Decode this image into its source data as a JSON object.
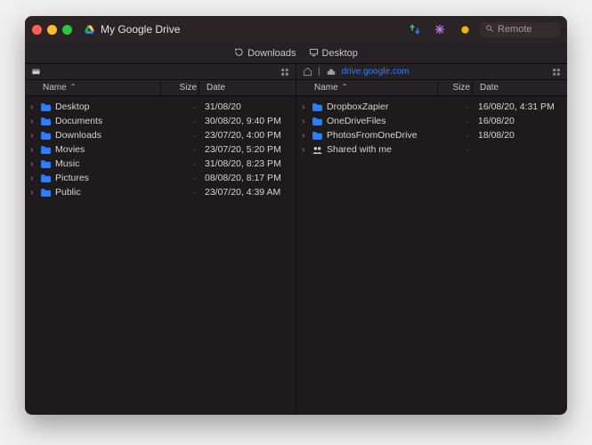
{
  "window": {
    "title": "My Google Drive"
  },
  "search": {
    "placeholder": "Remote"
  },
  "tabs": {
    "downloads": "Downloads",
    "desktop": "Desktop"
  },
  "columns": {
    "name": "Name",
    "size": "Size",
    "date": "Date",
    "sort_asc": "⌃"
  },
  "left": {
    "location": "",
    "view_icon": "list",
    "rows": [
      {
        "name": "Desktop",
        "size": "·",
        "date": "31/08/20"
      },
      {
        "name": "Documents",
        "size": "·",
        "date": "30/08/20, 9:40 PM"
      },
      {
        "name": "Downloads",
        "size": "·",
        "date": "23/07/20, 4:00 PM"
      },
      {
        "name": "Movies",
        "size": "·",
        "date": "23/07/20, 5:20 PM"
      },
      {
        "name": "Music",
        "size": "·",
        "date": "31/08/20, 8:23 PM"
      },
      {
        "name": "Pictures",
        "size": "·",
        "date": "08/08/20, 8:17 PM"
      },
      {
        "name": "Public",
        "size": "·",
        "date": "23/07/20, 4:39 AM"
      }
    ]
  },
  "right": {
    "location": "drive.google.com",
    "rows": [
      {
        "name": "DropboxZapier",
        "size": "·",
        "date": "16/08/20, 4:31 PM",
        "icon": "folder"
      },
      {
        "name": "OneDriveFiles",
        "size": "·",
        "date": "16/08/20",
        "icon": "folder"
      },
      {
        "name": "PhotosFromOneDrive",
        "size": "·",
        "date": "18/08/20",
        "icon": "folder"
      },
      {
        "name": "Shared with me",
        "size": "·",
        "date": "",
        "icon": "shared"
      }
    ]
  },
  "icons": {
    "sync": "sync-icon",
    "asterisk": "asterisk-icon",
    "dot": "status-dot-icon",
    "search": "search-icon",
    "grid": "grid-icon",
    "cloud": "cloud-icon",
    "disk": "disk-icon",
    "home": "home-icon",
    "reload": "reload-icon",
    "desktop": "desktop-icon",
    "gdrive": "gdrive-icon"
  },
  "colors": {
    "folder": "#2d7ff9",
    "accent": "#2d7ff9",
    "status_dot": "#f4b400"
  }
}
